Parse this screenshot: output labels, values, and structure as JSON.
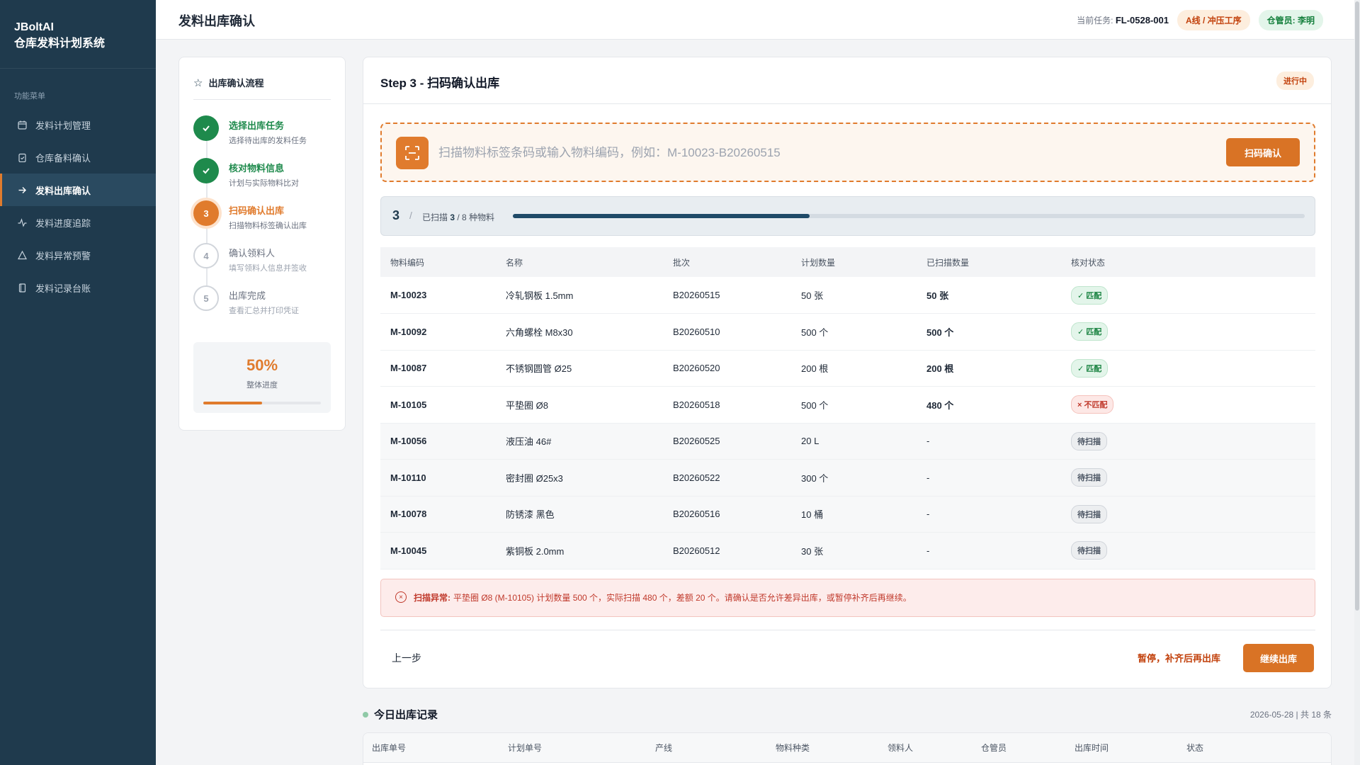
{
  "brand": {
    "line1": "JBoltAI",
    "line2": "仓库发料计划系统"
  },
  "sidebar": {
    "menu_title": "功能菜单",
    "items": [
      {
        "label": "发料计划管理",
        "icon": "calendar-icon"
      },
      {
        "label": "仓库备料确认",
        "icon": "clipboard-icon"
      },
      {
        "label": "发料出库确认",
        "icon": "arrow-right-icon",
        "active": true
      },
      {
        "label": "发料进度追踪",
        "icon": "activity-icon"
      },
      {
        "label": "发料异常预警",
        "icon": "warning-icon"
      },
      {
        "label": "发料记录台账",
        "icon": "book-icon"
      }
    ]
  },
  "header": {
    "title": "发料出库确认",
    "task_label": "当前任务:",
    "task_id": "FL-0528-001",
    "line_tag": "A线 / 冲压工序",
    "keeper_tag": "仓管员: 李明"
  },
  "steps": {
    "title": "出库确认流程",
    "items": [
      {
        "num": "1",
        "title": "选择出库任务",
        "desc": "选择待出库的发料任务",
        "state": "done"
      },
      {
        "num": "2",
        "title": "核对物料信息",
        "desc": "计划与实际物料比对",
        "state": "done"
      },
      {
        "num": "3",
        "title": "扫码确认出库",
        "desc": "扫描物料标签确认出库",
        "state": "active"
      },
      {
        "num": "4",
        "title": "确认领料人",
        "desc": "填写领料人信息并签收",
        "state": "todo"
      },
      {
        "num": "5",
        "title": "出库完成",
        "desc": "查看汇总并打印凭证",
        "state": "todo"
      }
    ],
    "progress_value": "50%",
    "progress_fraction": 0.5,
    "progress_label": "整体进度"
  },
  "main": {
    "title": "Step 3 - 扫码确认出库",
    "status": "进行中",
    "scan": {
      "placeholder": "扫描物料标签条码或输入物料编码，例如：M-10023-B20260515",
      "button": "扫码确认"
    },
    "scan_progress": {
      "count": "3",
      "sep": "/",
      "text_prefix": "已扫描",
      "scanned": "3",
      "total_text": "/ 8 种物料",
      "fraction": 0.375
    },
    "table": {
      "headers": [
        "物料编码",
        "名称",
        "批次",
        "计划数量",
        "已扫描数量",
        "核对状态"
      ],
      "rows": [
        {
          "code": "M-10023",
          "name": "冷轧钢板 1.5mm",
          "batch": "B20260515",
          "planned": "50 张",
          "scanned": "50 张",
          "status": "✓ 匹配",
          "state": "ok"
        },
        {
          "code": "M-10092",
          "name": "六角螺栓 M8x30",
          "batch": "B20260510",
          "planned": "500 个",
          "scanned": "500 个",
          "status": "✓ 匹配",
          "state": "ok"
        },
        {
          "code": "M-10087",
          "name": "不锈钢圆管 Ø25",
          "batch": "B20260520",
          "planned": "200 根",
          "scanned": "200 根",
          "status": "✓ 匹配",
          "state": "ok"
        },
        {
          "code": "M-10105",
          "name": "平垫圈 Ø8",
          "batch": "B20260518",
          "planned": "500 个",
          "scanned": "480 个",
          "status": "× 不匹配",
          "state": "bad"
        },
        {
          "code": "M-10056",
          "name": "液压油 46#",
          "batch": "B20260525",
          "planned": "20 L",
          "scanned": "-",
          "status": "待扫描",
          "state": "wait"
        },
        {
          "code": "M-10110",
          "name": "密封圈 Ø25x3",
          "batch": "B20260522",
          "planned": "300 个",
          "scanned": "-",
          "status": "待扫描",
          "state": "wait"
        },
        {
          "code": "M-10078",
          "name": "防锈漆 黑色",
          "batch": "B20260516",
          "planned": "10 桶",
          "scanned": "-",
          "status": "待扫描",
          "state": "wait"
        },
        {
          "code": "M-10045",
          "name": "紫铜板 2.0mm",
          "batch": "B20260512",
          "planned": "30 张",
          "scanned": "-",
          "status": "待扫描",
          "state": "wait"
        }
      ]
    },
    "alert": {
      "title": "扫描异常:",
      "message": "平垫圈 Ø8 (M-10105) 计划数量 500 个，实际扫描 480 个，差额 20 个。请确认是否允许差异出库，或暂停补齐后再继续。"
    },
    "footer": {
      "prev": "上一步",
      "pause": "暂停，补齐后再出库",
      "continue": "继续出库"
    }
  },
  "records": {
    "title": "今日出库记录",
    "meta": "2026-05-28 | 共 18 条",
    "columns": [
      "出库单号",
      "计划单号",
      "产线",
      "物料种类",
      "领料人",
      "仓管员",
      "出库时间",
      "状态"
    ]
  },
  "colors": {
    "sidebar_bg": "#1f3a4d",
    "accent_orange": "#e07b2d",
    "success_green": "#1e8a4c",
    "danger_red": "#c0392b"
  }
}
